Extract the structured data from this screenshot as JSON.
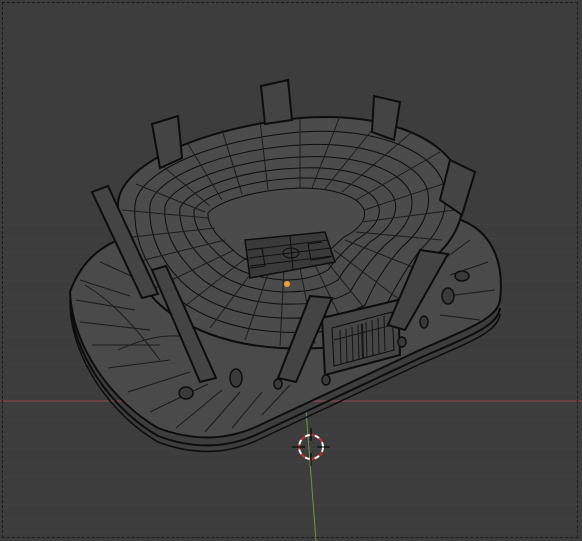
{
  "viewport": {
    "mode": "wireframe",
    "background_color": "#3d3d3d",
    "grid_color": "#474747",
    "wire_color": "#0d0d0d",
    "x_axis_color": "#9a4a55",
    "y_axis_color": "#6a9a3a",
    "cursor_colors": [
      "#c83232",
      "#ffffff"
    ],
    "origin_color": "#f0a030"
  },
  "scene": {
    "object": "stadium",
    "elements": [
      "bowl",
      "pitch",
      "pylons",
      "base-platform",
      "entrance-gate",
      "lamp-posts"
    ],
    "tool": "3d-cursor-icon"
  }
}
